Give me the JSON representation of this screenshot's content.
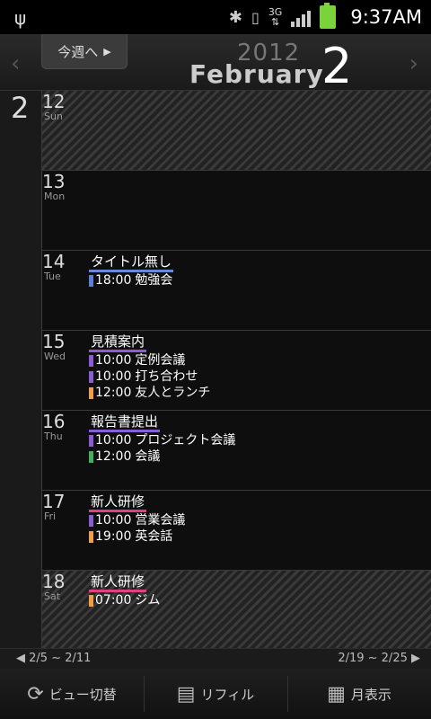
{
  "status": {
    "time": "9:37AM",
    "network": "3G"
  },
  "header": {
    "this_week_label": "今週へ",
    "year": "2012",
    "month": "February",
    "week_number": "2"
  },
  "side": {
    "week_number": "2"
  },
  "days": [
    {
      "num": "12",
      "name": "Sun",
      "weekend": true,
      "events": []
    },
    {
      "num": "13",
      "name": "Mon",
      "weekend": false,
      "events": []
    },
    {
      "num": "14",
      "name": "Tue",
      "weekend": false,
      "title": "タイトル無し",
      "title_color": "#6a87d8",
      "events": [
        {
          "time": "18:00",
          "label": "勉強会",
          "color": "#5b7fd6"
        }
      ]
    },
    {
      "num": "15",
      "name": "Wed",
      "weekend": false,
      "title": "見積案内",
      "title_color": "#8b5cd6",
      "events": [
        {
          "time": "10:00",
          "label": "定例会議",
          "color": "#8b5cd6"
        },
        {
          "time": "10:00",
          "label": "打ち合わせ",
          "color": "#8b5cd6"
        },
        {
          "time": "12:00",
          "label": "友人とランチ",
          "color": "#f0a040"
        }
      ]
    },
    {
      "num": "16",
      "name": "Thu",
      "weekend": false,
      "title": "報告書提出",
      "title_color": "#8b5cd6",
      "events": [
        {
          "time": "10:00",
          "label": "プロジェクト会議",
          "color": "#8b5cd6"
        },
        {
          "time": "12:00",
          "label": "会議",
          "color": "#3fb060"
        }
      ]
    },
    {
      "num": "17",
      "name": "Fri",
      "weekend": false,
      "title": "新人研修",
      "title_color": "#e04080",
      "events": [
        {
          "time": "10:00",
          "label": "営業会議",
          "color": "#8b5cd6"
        },
        {
          "time": "19:00",
          "label": "英会話",
          "color": "#f0a040"
        }
      ]
    },
    {
      "num": "18",
      "name": "Sat",
      "weekend": true,
      "title": "新人研修",
      "title_color": "#e04080",
      "events": [
        {
          "time": "07:00",
          "label": "ジム",
          "color": "#f0a040"
        }
      ]
    }
  ],
  "range": {
    "prev": "2/5 ~ 2/11",
    "next": "2/19 ~ 2/25"
  },
  "toolbar": {
    "view_toggle": "ビュー切替",
    "refill": "リフィル",
    "month_view": "月表示"
  }
}
